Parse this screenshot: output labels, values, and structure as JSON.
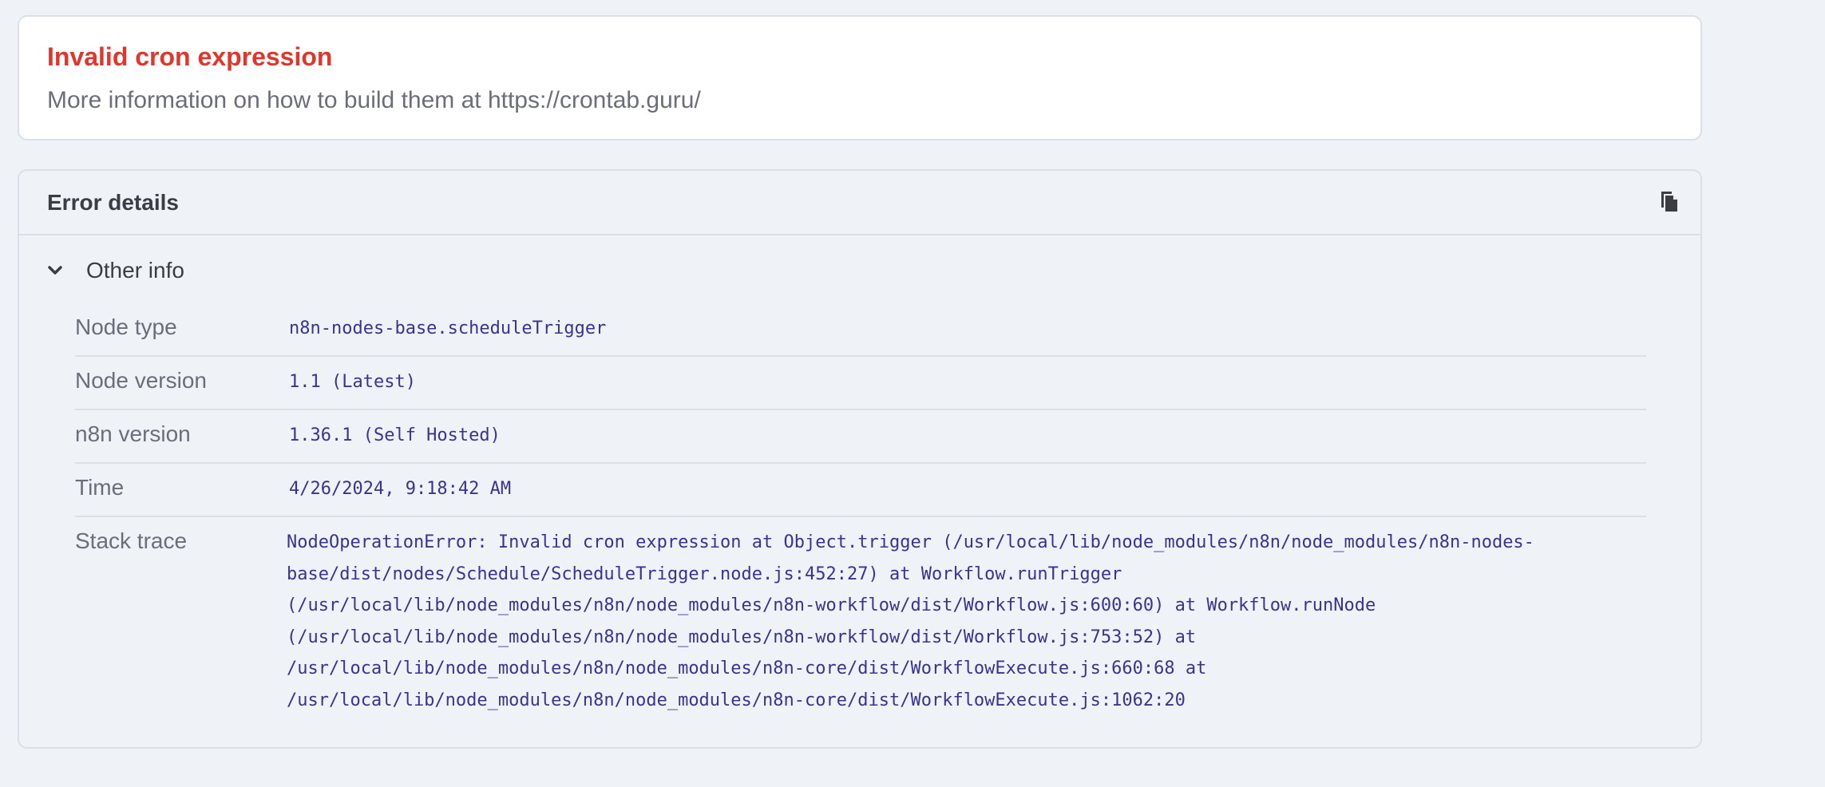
{
  "error": {
    "title": "Invalid cron expression",
    "description": "More information on how to build them at https://crontab.guru/"
  },
  "details": {
    "title": "Error details",
    "copy_icon": "copy-icon",
    "section_label": "Other info",
    "section_expanded": true,
    "rows": [
      {
        "key": "Node type",
        "value": "n8n-nodes-base.scheduleTrigger"
      },
      {
        "key": "Node version",
        "value": "1.1 (Latest)"
      },
      {
        "key": "n8n version",
        "value": "1.36.1 (Self Hosted)"
      },
      {
        "key": "Time",
        "value": "4/26/2024, 9:18:42 AM"
      },
      {
        "key": "Stack trace",
        "value": "NodeOperationError: Invalid cron expression at Object.trigger (/usr/local/lib/node_modules/n8n/node_modules/n8n-nodes-\nbase/dist/nodes/Schedule/ScheduleTrigger.node.js:452:27) at Workflow.runTrigger\n(/usr/local/lib/node_modules/n8n/node_modules/n8n-workflow/dist/Workflow.js:600:60) at Workflow.runNode\n(/usr/local/lib/node_modules/n8n/node_modules/n8n-workflow/dist/Workflow.js:753:52) at\n/usr/local/lib/node_modules/n8n/node_modules/n8n-core/dist/WorkflowExecute.js:660:68 at\n/usr/local/lib/node_modules/n8n/node_modules/n8n-core/dist/WorkflowExecute.js:1062:20"
      }
    ]
  },
  "colors": {
    "error_title": "#e0362b",
    "value_text": "#3a3490",
    "muted_text": "#6b6e79",
    "background": "#eff2f7",
    "border": "#dbdfe7"
  }
}
